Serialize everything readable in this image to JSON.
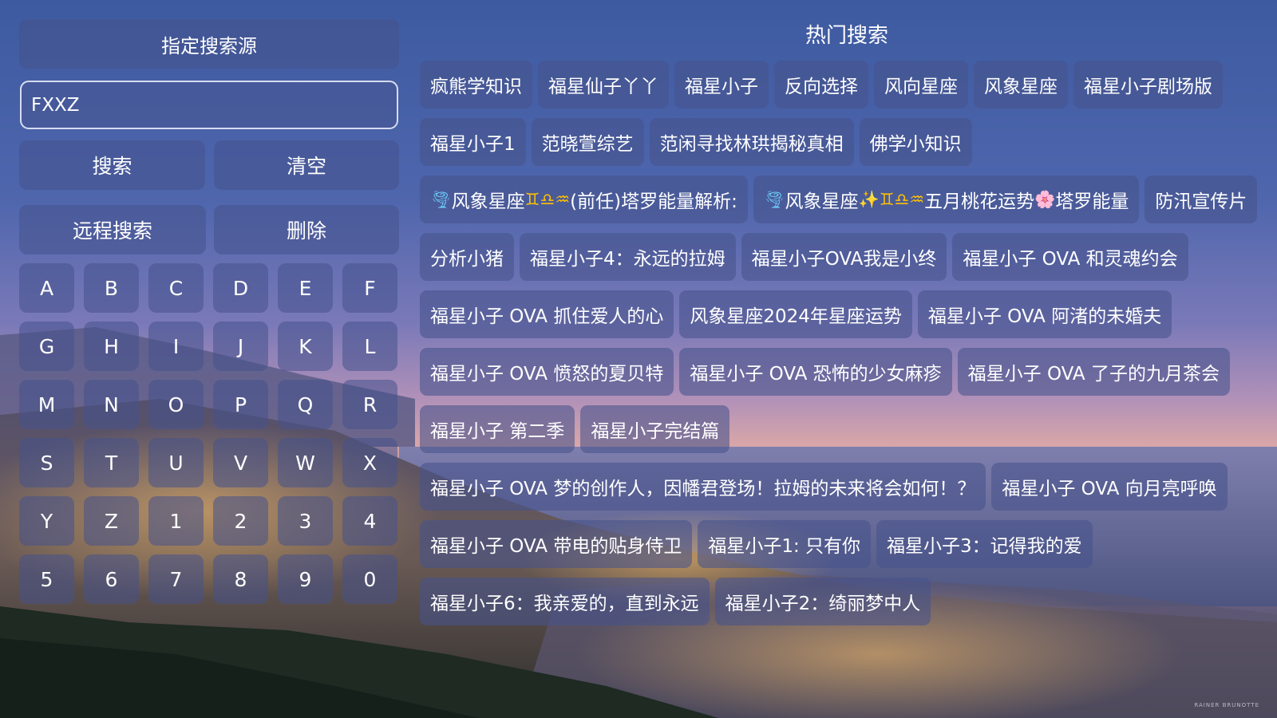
{
  "left_panel": {
    "source_button": "指定搜索源",
    "search_value": "FXXZ",
    "search_button": "搜索",
    "clear_button": "清空",
    "remote_search_button": "远程搜索",
    "delete_button": "删除",
    "keys": [
      "A",
      "B",
      "C",
      "D",
      "E",
      "F",
      "G",
      "H",
      "I",
      "J",
      "K",
      "L",
      "M",
      "N",
      "O",
      "P",
      "Q",
      "R",
      "S",
      "T",
      "U",
      "V",
      "W",
      "X",
      "Y",
      "Z",
      "1",
      "2",
      "3",
      "4",
      "5",
      "6",
      "7",
      "8",
      "9",
      "0"
    ]
  },
  "hot_search": {
    "title": "热门搜索",
    "items": [
      {
        "text": "疯熊学知识"
      },
      {
        "text": "福星仙子丫丫"
      },
      {
        "text": "福星小子"
      },
      {
        "text": "反向选择"
      },
      {
        "text": "风向星座"
      },
      {
        "text": "风象星座"
      },
      {
        "text": "福星小子剧场版"
      },
      {
        "text": "福星小子1"
      },
      {
        "text": "范晓萱综艺"
      },
      {
        "text": "范闲寻找林珙揭秘真相"
      },
      {
        "text": "佛学小知识"
      },
      {
        "text": "🌪风象星座♊♎♒(前任)塔罗能量解析:",
        "parts": [
          {
            "emoji": "🌪",
            "icon": "tornado-icon",
            "color": "#6fd3ff"
          },
          {
            "text": "风象星座"
          },
          {
            "emoji": "♊",
            "icon": "gemini-icon",
            "color": "#ffc000"
          },
          {
            "emoji": "♎",
            "icon": "libra-icon",
            "color": "#ffc000"
          },
          {
            "emoji": "♒",
            "icon": "aquarius-icon",
            "color": "#ffc000"
          },
          {
            "text": "(前任)塔罗能量解析:"
          }
        ]
      },
      {
        "text": "🌪风象星座✨♊♎♒五月桃花运势🌸塔罗能量",
        "parts": [
          {
            "emoji": "🌪",
            "icon": "tornado-icon",
            "color": "#6fd3ff"
          },
          {
            "text": "风象星座"
          },
          {
            "emoji": "✨",
            "icon": "sparkles-icon",
            "color": "#ffb020"
          },
          {
            "emoji": "♊",
            "icon": "gemini-icon",
            "color": "#ffc000"
          },
          {
            "emoji": "♎",
            "icon": "libra-icon",
            "color": "#ffc000"
          },
          {
            "emoji": "♒",
            "icon": "aquarius-icon",
            "color": "#ffc000"
          },
          {
            "text": "五月桃花运势"
          },
          {
            "emoji": "🌸",
            "icon": "cherry-blossom-icon",
            "color": "#ff6fa8"
          },
          {
            "text": "塔罗能量"
          }
        ]
      },
      {
        "text": "防汛宣传片"
      },
      {
        "text": "分析小猪"
      },
      {
        "text": "福星小子4：永远的拉姆"
      },
      {
        "text": "福星小子OVA我是小终"
      },
      {
        "text": "福星小子 OVA 和灵魂约会"
      },
      {
        "text": "福星小子 OVA 抓住爱人的心"
      },
      {
        "text": "风象星座2024年星座运势"
      },
      {
        "text": "福星小子 OVA 阿渚的未婚夫"
      },
      {
        "text": "福星小子 OVA 愤怒的夏贝特"
      },
      {
        "text": "福星小子 OVA 恐怖的少女麻疹"
      },
      {
        "text": "福星小子 OVA 了子的九月茶会"
      },
      {
        "text": "福星小子 第二季"
      },
      {
        "text": "福星小子完结篇"
      },
      {
        "text": "福星小子 OVA 梦的创作人，因幡君登场！拉姆的未来将会如何！？"
      },
      {
        "text": "福星小子 OVA 向月亮呼唤"
      },
      {
        "text": "福星小子 OVA 带电的贴身侍卫"
      },
      {
        "text": "福星小子1: 只有你"
      },
      {
        "text": "福星小子3：记得我的爱"
      },
      {
        "text": "福星小子6：我亲爱的，直到永远"
      },
      {
        "text": "福星小子2：绮丽梦中人"
      }
    ]
  },
  "watermark": "RAINER BRUNOTTE"
}
